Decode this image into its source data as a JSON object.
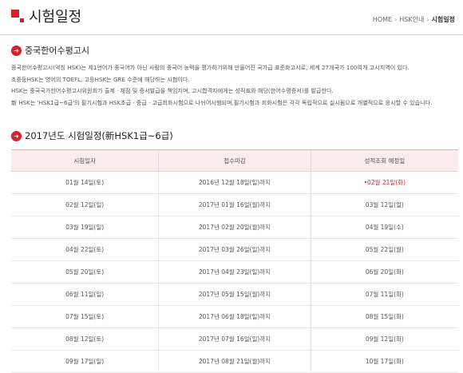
{
  "header": {
    "title": "시험일정",
    "breadcrumb": [
      "HOME",
      "HSK안내",
      "시험일정"
    ]
  },
  "intro": {
    "heading": "중국한어수평고시",
    "lines": [
      "중국한어수평고시(약칭 HSK)는 제1언어가 중국어가 아닌 사람의 중국어 능력을 평가하기위해 만들어진 국가급 표준화고시로, 세계 27개국가 100여개 고시지역이 있다.",
      "초중등HSK는 영어의 TOEFL, 고등HSK는 GRE 수준에 해당하는 시험이다.",
      "HSK는 중국국가한어수평고시위원회가 출제ㆍ채점 및 증서발급을 책임지며, 고시합격자에게는 성적표와 해당(한어수평증서)를 발급한다.",
      "新 HSK는 'HSK1급~6급'의 필기시험과 HSK초급ㆍ중급ㆍ고급회화시험으로 나뉘어시행되며,필기시험과 회화시험은 각각 독립적으로 실시됨으로 개별적으로 응시할 수 있습니다."
    ]
  },
  "schedule": {
    "heading": "2017년도 시험일정(新HSK1급~6급)",
    "columns": [
      "시험일자",
      "접수마감",
      "성적조회 예정일"
    ],
    "rows": [
      [
        "01월 14일(토)",
        "2016년 12월 18일(일)까지",
        "02월 21일(화)"
      ],
      [
        "02월 12일(일)",
        "2017년 01월 16일(월)까지",
        "03월 12일(일)"
      ],
      [
        "03월 19일(일)",
        "2017년 02월 20일(월)까지",
        "04월 19일(수)"
      ],
      [
        "04월 22일(토)",
        "2017년 03월 26일(일)까지",
        "05월 22일(월)"
      ],
      [
        "05월 20일(토)",
        "2017년 04월 23일(일)까지",
        "06월 20일(화)"
      ],
      [
        "06월 11일(일)",
        "2017년 05월 15일(월)까지",
        "07월 11일(화)"
      ],
      [
        "07월 15일(토)",
        "2017년 06월 18일(일)까지",
        "08월 15일(화)"
      ],
      [
        "08월 12일(토)",
        "2017년 07월 16일(일)까지",
        "09월 12일(화)"
      ],
      [
        "09월 17일(일)",
        "2017년 08월 21일(월)까지",
        "10월 17일(화)"
      ]
    ],
    "highlight_prefix": "•",
    "highlight_color": "#e0262b"
  },
  "icons": {
    "title_mark": "red-squares-icon",
    "section_bullet": "arrow-circle-icon"
  },
  "colors": {
    "accent": "#d7202c",
    "table_header_bg": "#faeceb"
  }
}
